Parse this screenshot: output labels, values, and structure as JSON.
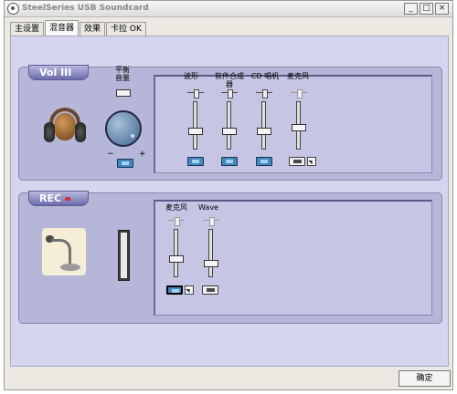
{
  "window": {
    "title": "SteelSeries USB Soundcard",
    "controls": [
      "_",
      "□",
      "×"
    ]
  },
  "tabs": [
    {
      "label": "主设置",
      "active": false
    },
    {
      "label": "混音器",
      "active": true
    },
    {
      "label": "效果",
      "active": false
    },
    {
      "label": "卡拉 OK",
      "active": false
    }
  ],
  "volume_panel": {
    "tag": "Vol III",
    "balance_label": "平衡\n音量",
    "minus": "−",
    "plus": "+",
    "channels": [
      {
        "label": "波形",
        "mute_style": "blue",
        "level": 0.35
      },
      {
        "label": "软件合成\n器",
        "mute_style": "blue",
        "level": 0.35
      },
      {
        "label": "CD 唱机",
        "mute_style": "blue",
        "level": 0.35
      },
      {
        "label": "麦克风",
        "mute_style": "grey",
        "level": 0.45,
        "disabled": true
      }
    ],
    "master_level": 0.6
  },
  "record_panel": {
    "tag": "REC",
    "channels": [
      {
        "label": "麦克风",
        "selected": true,
        "level": 0.35
      },
      {
        "label": "Wave",
        "selected": false,
        "level": 0.25
      }
    ],
    "meter_level": 0.0
  },
  "footer": {
    "ok_label": "确定"
  },
  "colors": {
    "panel": "#b6b6d8",
    "background": "#d5d5ee",
    "accent": "#4488bb"
  }
}
